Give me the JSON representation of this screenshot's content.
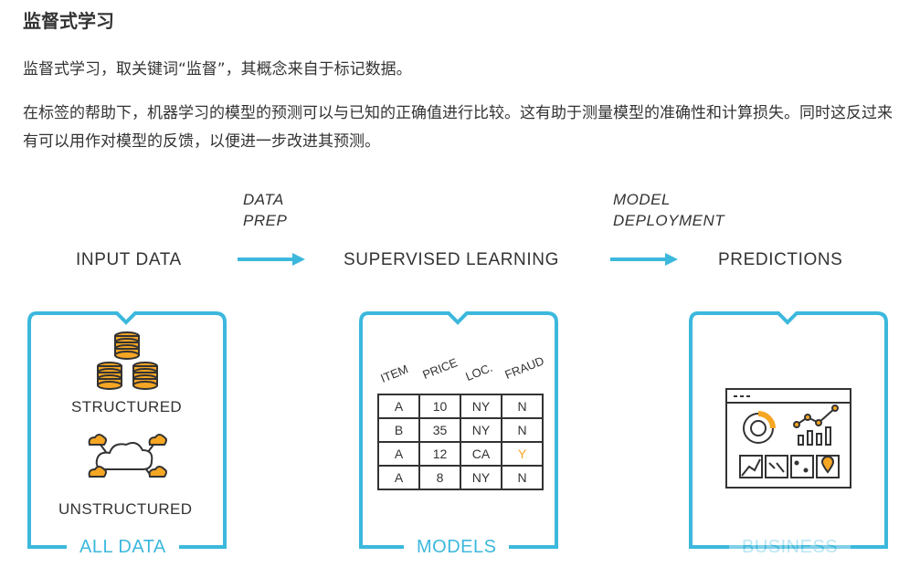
{
  "article": {
    "heading": "监督式学习",
    "paragraph1": "监督式学习，取关键词“监督”，其概念来自于标记数据。",
    "paragraph2": "在标签的帮助下，机器学习的模型的预测可以与已知的正确值进行比较。这有助于测量模型的准确性和计算损失。同时这反过来有可以用作对模型的反馈，以便进一步改进其预测。"
  },
  "diagram": {
    "stages": [
      "INPUT DATA",
      "SUPERVISED LEARNING",
      "PREDICTIONS"
    ],
    "transitions": [
      {
        "line1": "DATA",
        "line2": "PREP"
      },
      {
        "line1": "MODEL",
        "line2": "DEPLOYMENT"
      }
    ],
    "cards": [
      {
        "title": "ALL DATA",
        "items": [
          "STRUCTURED",
          "UNSTRUCTURED"
        ]
      },
      {
        "title": "MODELS"
      },
      {
        "title": "BUSINESS"
      }
    ],
    "table": {
      "headers": [
        "ITEM",
        "PRICE",
        "LOC.",
        "FRAUD"
      ],
      "rows": [
        [
          "A",
          "10",
          "NY",
          "N"
        ],
        [
          "B",
          "35",
          "NY",
          "N"
        ],
        [
          "A",
          "12",
          "CA",
          "Y"
        ],
        [
          "A",
          "8",
          "NY",
          "N"
        ]
      ]
    },
    "colors": {
      "accent": "#3cb8dd",
      "highlight": "#f5a623",
      "ink": "#333333"
    },
    "icons": [
      "database-icon",
      "cloud-network-icon",
      "dashboard-icon"
    ]
  }
}
